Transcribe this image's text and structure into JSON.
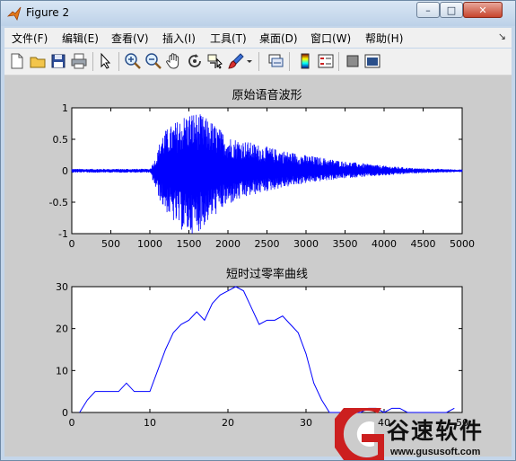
{
  "window": {
    "title": "Figure 2",
    "min_label": "–",
    "max_label": "□",
    "close_label": "✕"
  },
  "menubar": {
    "items": [
      "文件(F)",
      "编辑(E)",
      "查看(V)",
      "插入(I)",
      "工具(T)",
      "桌面(D)",
      "窗口(W)",
      "帮助(H)"
    ],
    "overflow": "↘"
  },
  "toolbar": {
    "icons": [
      "new-figure-icon",
      "open-file-icon",
      "save-icon",
      "print-icon",
      "edit-plot-arrow-icon",
      "zoom-in-icon",
      "zoom-out-icon",
      "pan-hand-icon",
      "rotate-3d-icon",
      "data-cursor-icon",
      "brush-icon",
      "brush-dropdown-icon",
      "link-plot-icon",
      "insert-colorbar-icon",
      "insert-legend-icon",
      "hide-plot-tools-icon",
      "show-plot-tools-icon"
    ]
  },
  "watermark": {
    "text": "谷速软件",
    "url": "www.gususoft.com",
    "color": "#cc1f1f"
  },
  "chart_data": [
    {
      "type": "line",
      "title": "原始语音波形",
      "xlabel": "",
      "ylabel": "",
      "xlim": [
        0,
        5000
      ],
      "ylim": [
        -1,
        1
      ],
      "xticks": [
        0,
        500,
        1000,
        1500,
        2000,
        2500,
        3000,
        3500,
        4000,
        4500,
        5000
      ],
      "yticks": [
        -1,
        -0.5,
        0,
        0.5,
        1
      ],
      "color": "#0000ff",
      "grid": false,
      "envelope": {
        "x": [
          0,
          1000,
          1090,
          1150,
          1300,
          1450,
          1550,
          1650,
          1800,
          2000,
          2300,
          2600,
          3000,
          3500,
          4000,
          4400,
          5000
        ],
        "upper": [
          0.03,
          0.03,
          0.25,
          0.6,
          0.75,
          0.9,
          0.95,
          0.9,
          0.78,
          0.55,
          0.45,
          0.35,
          0.25,
          0.15,
          0.08,
          0.04,
          0.02
        ],
        "lower": [
          -0.03,
          -0.03,
          -0.35,
          -0.55,
          -0.82,
          -1.0,
          -1.0,
          -0.95,
          -0.75,
          -0.55,
          -0.4,
          -0.3,
          -0.2,
          -0.12,
          -0.08,
          -0.04,
          -0.02
        ]
      }
    },
    {
      "type": "line",
      "title": "短时过零率曲线",
      "xlabel": "",
      "ylabel": "",
      "xlim": [
        0,
        50
      ],
      "ylim": [
        0,
        30
      ],
      "xticks": [
        0,
        10,
        20,
        30,
        40,
        50
      ],
      "yticks": [
        0,
        10,
        20,
        30
      ],
      "color": "#0000ff",
      "grid": false,
      "x": [
        1,
        2,
        3,
        4,
        5,
        6,
        7,
        8,
        9,
        10,
        11,
        12,
        13,
        14,
        15,
        16,
        17,
        18,
        19,
        20,
        21,
        22,
        23,
        24,
        25,
        26,
        27,
        28,
        29,
        30,
        31,
        32,
        33,
        34,
        35,
        36,
        37,
        38,
        39,
        40,
        41,
        42,
        43,
        44,
        45,
        46,
        47,
        48,
        49
      ],
      "values": [
        0,
        3,
        5,
        5,
        5,
        5,
        7,
        5,
        5,
        5,
        10,
        15,
        19,
        21,
        22,
        24,
        22,
        26,
        28,
        29,
        30,
        29,
        25,
        21,
        22,
        22,
        23,
        21,
        19,
        14,
        7,
        3,
        0,
        0,
        0,
        0,
        0,
        1,
        1,
        0,
        1,
        1,
        0,
        0,
        0,
        0,
        0,
        0,
        1
      ]
    }
  ]
}
